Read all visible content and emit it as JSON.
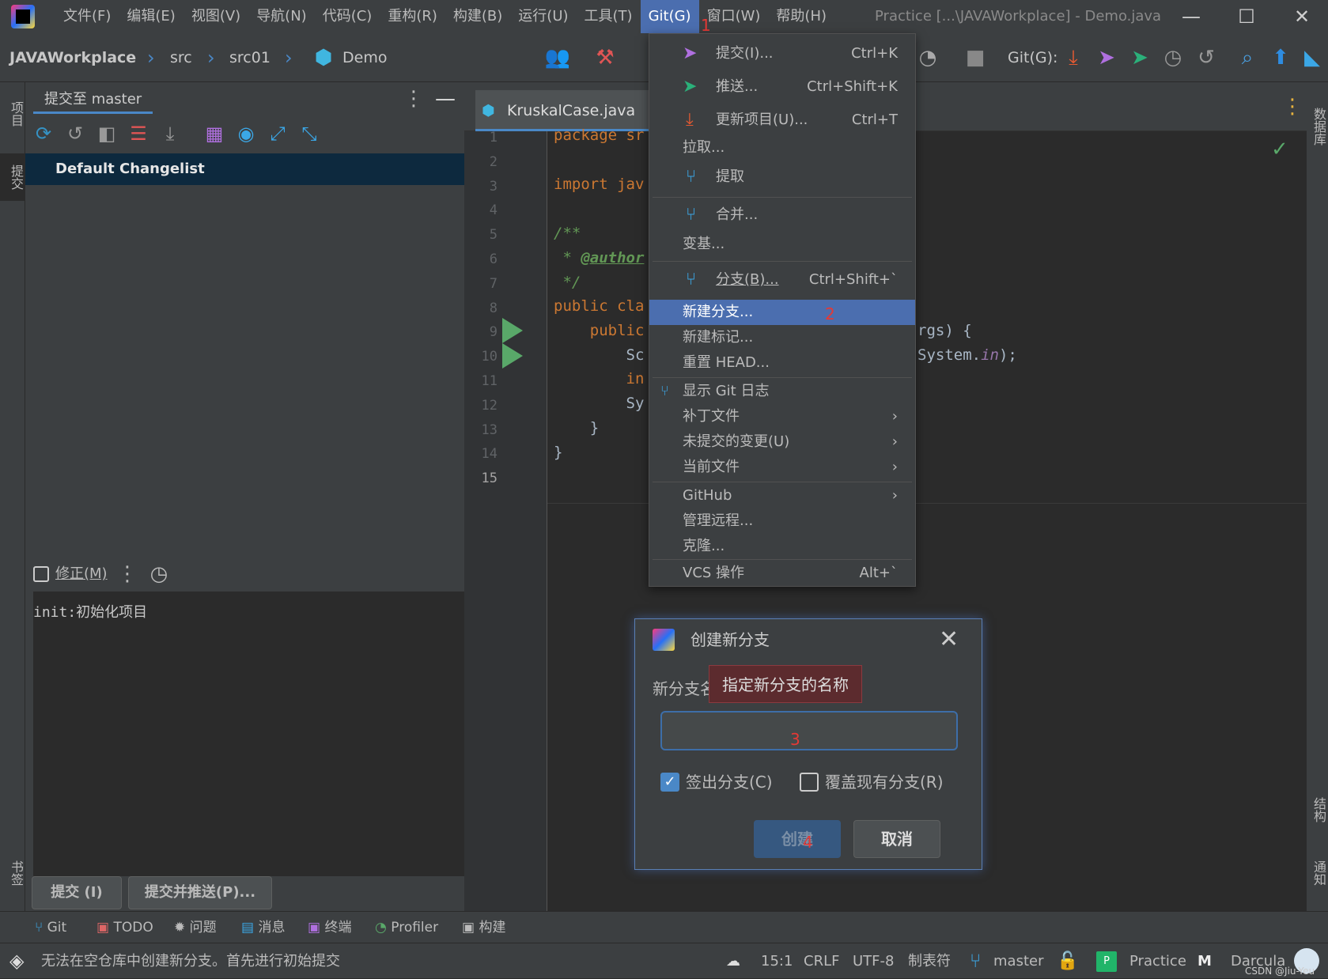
{
  "window": {
    "title": "Practice [...\\JAVAWorkplace] - Demo.java"
  },
  "menubar": [
    "文件(F)",
    "编辑(E)",
    "视图(V)",
    "导航(N)",
    "代码(C)",
    "重构(R)",
    "构建(B)",
    "运行(U)",
    "工具(T)",
    "Git(G)",
    "窗口(W)",
    "帮助(H)"
  ],
  "breadcrumb": {
    "project": "JAVAWorkplace",
    "src": "src",
    "pkg": "src01",
    "file": "Demo"
  },
  "navbar": {
    "git_label": "Git(G):"
  },
  "commit_panel": {
    "tab": "提交至 master",
    "changelist": "Default Changelist",
    "amend": "修正(M)",
    "message": "init:初始化项目",
    "commit_btn": "提交 (I)",
    "commit_push_btn": "提交并推送(P)..."
  },
  "stripe": {
    "project": "项目",
    "commit": "提交",
    "bookmarks": "书签",
    "database": "数据库",
    "structure": "结构",
    "notifications": "通知"
  },
  "editor": {
    "tab": "KruskalCase.java",
    "lines": [
      "1",
      "2",
      "3",
      "4",
      "5",
      "6",
      "7",
      "8",
      "9",
      "10",
      "11",
      "12",
      "13",
      "14",
      "15"
    ],
    "code": {
      "l1": "package sr",
      "l3": "import jav",
      "l5": "/**",
      "l6a": " * ",
      "l6b": "@author",
      "l7": " */",
      "l8": "public cla",
      "l9": "    public",
      "l9r": "rgs) {",
      "l10": "        Sc",
      "l10r": "System.",
      "l10r2": "in",
      "l10r3": ");",
      "l11": "        in",
      "l12": "        Sy",
      "l13": "    }",
      "l14": "}"
    }
  },
  "git_menu": {
    "commit": "提交(I)...",
    "commit_sc": "Ctrl+K",
    "push": "推送...",
    "push_sc": "Ctrl+Shift+K",
    "update": "更新项目(U)...",
    "update_sc": "Ctrl+T",
    "pull": "拉取...",
    "fetch": "提取",
    "merge": "合并...",
    "rebase": "变基...",
    "branches": "分支(B)...",
    "branches_sc": "Ctrl+Shift+`",
    "new_branch": "新建分支...",
    "new_tag": "新建标记...",
    "reset_head": "重置 HEAD...",
    "show_log": "显示 Git 日志",
    "patch": "补丁文件",
    "uncommitted": "未提交的变更(U)",
    "current_file": "当前文件",
    "github": "GitHub",
    "remotes": "管理远程...",
    "clone": "克隆...",
    "vcs_ops": "VCS 操作",
    "vcs_sc": "Alt+`"
  },
  "dialog": {
    "title": "创建新分支",
    "field_label": "新分支名",
    "tooltip": "指定新分支的名称",
    "input_value": "",
    "checkout": "签出分支(C)",
    "checkout_checked": true,
    "overwrite": "覆盖现有分支(R)",
    "overwrite_checked": false,
    "create_btn": "创建",
    "cancel_btn": "取消"
  },
  "annotations": [
    "1",
    "2",
    "3",
    "4"
  ],
  "tool_tabs": [
    "Git",
    "TODO",
    "问题",
    "消息",
    "终端",
    "Profiler",
    "构建"
  ],
  "statusbar": {
    "message": "无法在空仓库中创建新分支。首先进行初始提交",
    "position": "15:1",
    "line_sep": "CRLF",
    "encoding": "UTF-8",
    "indent": "制表符",
    "branch": "master",
    "project": "Practice",
    "theme": "Darcula",
    "watermark": "CSDN @Jiu-Yeu"
  },
  "colors": {
    "accent": "#4b6eaf",
    "selection": "#0d293e",
    "keyword": "#cc7832",
    "doc": "#629755",
    "run": "#59a869",
    "annotation": "#e53935"
  }
}
